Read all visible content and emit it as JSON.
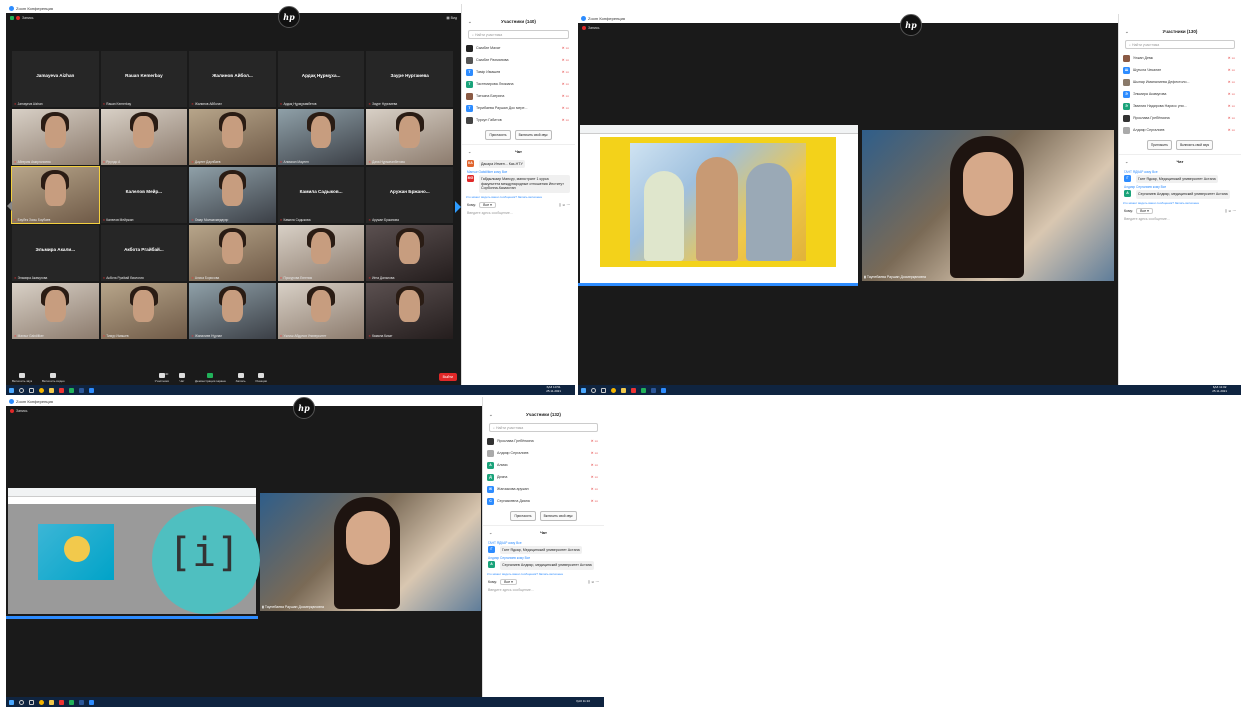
{
  "window_title": "Zoom Конференция",
  "recording_label": "Запись",
  "view_label": "Вид",
  "hp_logo": "hp",
  "screen1": {
    "participants_header": "Участники (140)",
    "search_placeholder": "Найти участника",
    "participants": [
      {
        "name": "Сымбат Махат",
        "avatar_color": "#222222",
        "initial": ""
      },
      {
        "name": "Сымбат Рахманова",
        "avatar_color": "#555555",
        "initial": ""
      },
      {
        "name": "Тамір Имашев",
        "avatar_color": "#2d8cff",
        "initial": "Т"
      },
      {
        "name": "Тастемирова Люзиана",
        "avatar_color": "#1aa37a",
        "initial": "Т"
      },
      {
        "name": "Татьяна Батрина",
        "avatar_color": "#8a5a44",
        "initial": ""
      },
      {
        "name": "Терибаева Раушан Дос мере...",
        "avatar_color": "#2d8cff",
        "initial": "Т"
      },
      {
        "name": "Турсун Габитов",
        "avatar_color": "#444444",
        "initial": ""
      }
    ],
    "invite_label": "Пригласить",
    "unmute_label": "Включить свой звук",
    "chat_label": "Чат",
    "messages": [
      {
        "from": "",
        "avatar": "КА",
        "avatar_color": "#e0642d",
        "text": "Дакара Итмен... Каз-НТУ"
      },
      {
        "from": "Mansur Gabdiltker кому Все",
        "avatar": "MG",
        "avatar_color": "#e02828",
        "text": "Габдылкаир Мансур, магистрант 1 курса факультета международные отношения Институт Сорбонна-Казахстан"
      }
    ],
    "visibility_note": "Кто может видеть ваши сообщения? Запись включена",
    "to_label": "Кому:",
    "to_value": "Все",
    "input_placeholder": "Введите здесь сообщение...",
    "tiles": [
      {
        "big": "Jamayeva Aizhan",
        "nm": "Jamayeva Aizhan",
        "kind": "dark"
      },
      {
        "big": "Rauan Kemerbay",
        "nm": "Rauan Kemerbay",
        "kind": "dark"
      },
      {
        "big": "Жалинов Айбол...",
        "nm": "Жалинов Айболат",
        "kind": "dark"
      },
      {
        "big": "Ардақ Нұрмұха...",
        "nm": "Ардақ Нұрмұхамбетов",
        "kind": "dark"
      },
      {
        "big": "Зауре Нургаиева",
        "nm": "Зауре Нургаиева",
        "kind": "dark"
      },
      {
        "big": "",
        "nm": "Айгерим Амиргалиева",
        "kind": "v3"
      },
      {
        "big": "",
        "nm": "Ррүлдо А",
        "kind": "v3"
      },
      {
        "big": "",
        "nm": "Дәулет Даулбаев",
        "kind": "v"
      },
      {
        "big": "",
        "nm": "Алимхан Маулен",
        "kind": "v2"
      },
      {
        "big": "",
        "nm": "Дана Нұрмағанбетова",
        "kind": "v3"
      },
      {
        "big": "",
        "nm": "Баубек Зоиш Баубаев",
        "kind": "v",
        "active": true
      },
      {
        "big": "Калелов Мейр...",
        "nm": "Калелов Мейржан",
        "kind": "dark"
      },
      {
        "big": "",
        "nm": "Омар Молмахмедауэр",
        "kind": "v2"
      },
      {
        "big": "Камила Садыков...",
        "nm": "Камила Садыкова",
        "kind": "dark"
      },
      {
        "big": "Аружан Бржано...",
        "nm": "Аружан Бржанова",
        "kind": "dark"
      },
      {
        "big": "Эльмира Акали...",
        "nm": "Эльмира Акамугова",
        "kind": "dark"
      },
      {
        "big": "Акбота Ргайбай...",
        "nm": "Акбота Рраibай биология",
        "kind": "dark"
      },
      {
        "big": "",
        "nm": "Алиса Борисова",
        "kind": "v"
      },
      {
        "big": "",
        "nm": "Прокурова Евгения",
        "kind": "v3"
      },
      {
        "big": "",
        "nm": "Игна Дальнова",
        "kind": "v4"
      },
      {
        "big": "",
        "nm": "Mansur Gabdiltker",
        "kind": "v3"
      },
      {
        "big": "",
        "nm": "Тимур Имашев",
        "kind": "v"
      },
      {
        "big": "",
        "nm": "Жаналиев Нұрлан",
        "kind": "v2"
      },
      {
        "big": "",
        "nm": "Уәлиш Абдулов Университет",
        "kind": "v3"
      },
      {
        "big": "",
        "nm": "Камила Кизат",
        "kind": "v4"
      }
    ],
    "toolbar": [
      {
        "label": "Включить звук",
        "color": "#dddddd"
      },
      {
        "label": "Включить видео",
        "color": "#dddddd"
      },
      {
        "label": "Участники",
        "color": "#dddddd"
      },
      {
        "label": "Чат",
        "color": "#dddddd"
      },
      {
        "label": "Демонстрация экрана",
        "color": "#21b25a"
      },
      {
        "label": "Запись",
        "color": "#dddddd"
      },
      {
        "label": "Реакции",
        "color": "#dddddd"
      }
    ],
    "participants_count": "140",
    "leave_label": "Выйти",
    "clock_time": "10:51",
    "clock_date": "25.11.2021",
    "lang": "ҚАЗ"
  },
  "screen2": {
    "participants_header": "Участники (130)",
    "search_placeholder": "Найти участника",
    "participants": [
      {
        "name": "Улжан Демк",
        "avatar_color": "#8a5a44",
        "initial": ""
      },
      {
        "name": "Шұғыла Чекалин",
        "avatar_color": "#2d8cff",
        "initial": "Ш"
      },
      {
        "name": "Шынар Иманалиева Дефектоло...",
        "avatar_color": "#8a7a6a",
        "initial": ""
      },
      {
        "name": "Эльмира Акамугова",
        "avatar_color": "#2d8cff",
        "initial": "Э"
      },
      {
        "name": "Эмилия Надирова Нарисс уни...",
        "avatar_color": "#1aa37a",
        "initial": "Э"
      },
      {
        "name": "Ярослава Гребёнкина",
        "avatar_color": "#333333",
        "initial": ""
      },
      {
        "name": "Алдияр Сергалиев",
        "avatar_color": "#aaaaaa",
        "initial": ""
      }
    ],
    "invite_label": "Пригласить",
    "unmute_label": "Включить свой звук",
    "chat_label": "Чат",
    "messages": [
      {
        "from": "ГАНТ ЯДКАР кому Все",
        "avatar": "Г",
        "avatar_color": "#2d8cff",
        "text": "Гант Ядкар, Медицинский университет Астана"
      },
      {
        "from": "Алдияр Сергалиев кому Все",
        "avatar": "А",
        "avatar_color": "#1aa37a",
        "text": "Сергалиев Алдияр, медицинский университет Астана"
      }
    ],
    "visibility_note": "Кто может видеть ваши сообщения? Запись включена",
    "to_label": "Кому:",
    "to_value": "Все",
    "input_placeholder": "Введите здесь сообщение...",
    "speaker_caption": "Таупебаева Раушан Досмерқановна",
    "clock_time": "11:02",
    "clock_date": "25.11.2021",
    "lang": "ҚАЗ"
  },
  "screen3": {
    "participants_header": "Участники (132)",
    "search_placeholder": "Найти участника",
    "participants": [
      {
        "name": "Ярослава Гребёнкина",
        "avatar_color": "#333333",
        "initial": ""
      },
      {
        "name": "Алдияр Сергалиев",
        "avatar_color": "#aaaaaa",
        "initial": ""
      },
      {
        "name": "Алмаз",
        "avatar_color": "#1aa37a",
        "initial": "А"
      },
      {
        "name": "Дияна",
        "avatar_color": "#1aa37a",
        "initial": "Д"
      },
      {
        "name": "Жанзакова аружан",
        "avatar_color": "#2d8cff",
        "initial": "Ж"
      },
      {
        "name": "Сергазиевна Диана",
        "avatar_color": "#2d8cff",
        "initial": "С"
      }
    ],
    "invite_label": "Пригласить",
    "unmute_label": "Включить свой звук",
    "chat_label": "Чат",
    "messages": [
      {
        "from": "ГАНТ ЯДКАР кому Все",
        "avatar": "Г",
        "avatar_color": "#2d8cff",
        "text": "Гант Ядкар, Медицинский университет Астана"
      },
      {
        "from": "Алдияр Сергалиев кому Все",
        "avatar": "А",
        "avatar_color": "#1aa37a",
        "text": "Сергалиев Алдияр, медицинский университет Астана"
      }
    ],
    "visibility_note": "Кто может видеть ваши сообщения? Запись включена",
    "to_label": "Кому:",
    "to_value": "Все",
    "input_placeholder": "Введите здесь сообщение...",
    "speaker_caption": "Таупебаева Раушан Досмерқановна",
    "slide_text": "[i]",
    "clock_time": "11:10",
    "lang": "ҚАЗ"
  }
}
